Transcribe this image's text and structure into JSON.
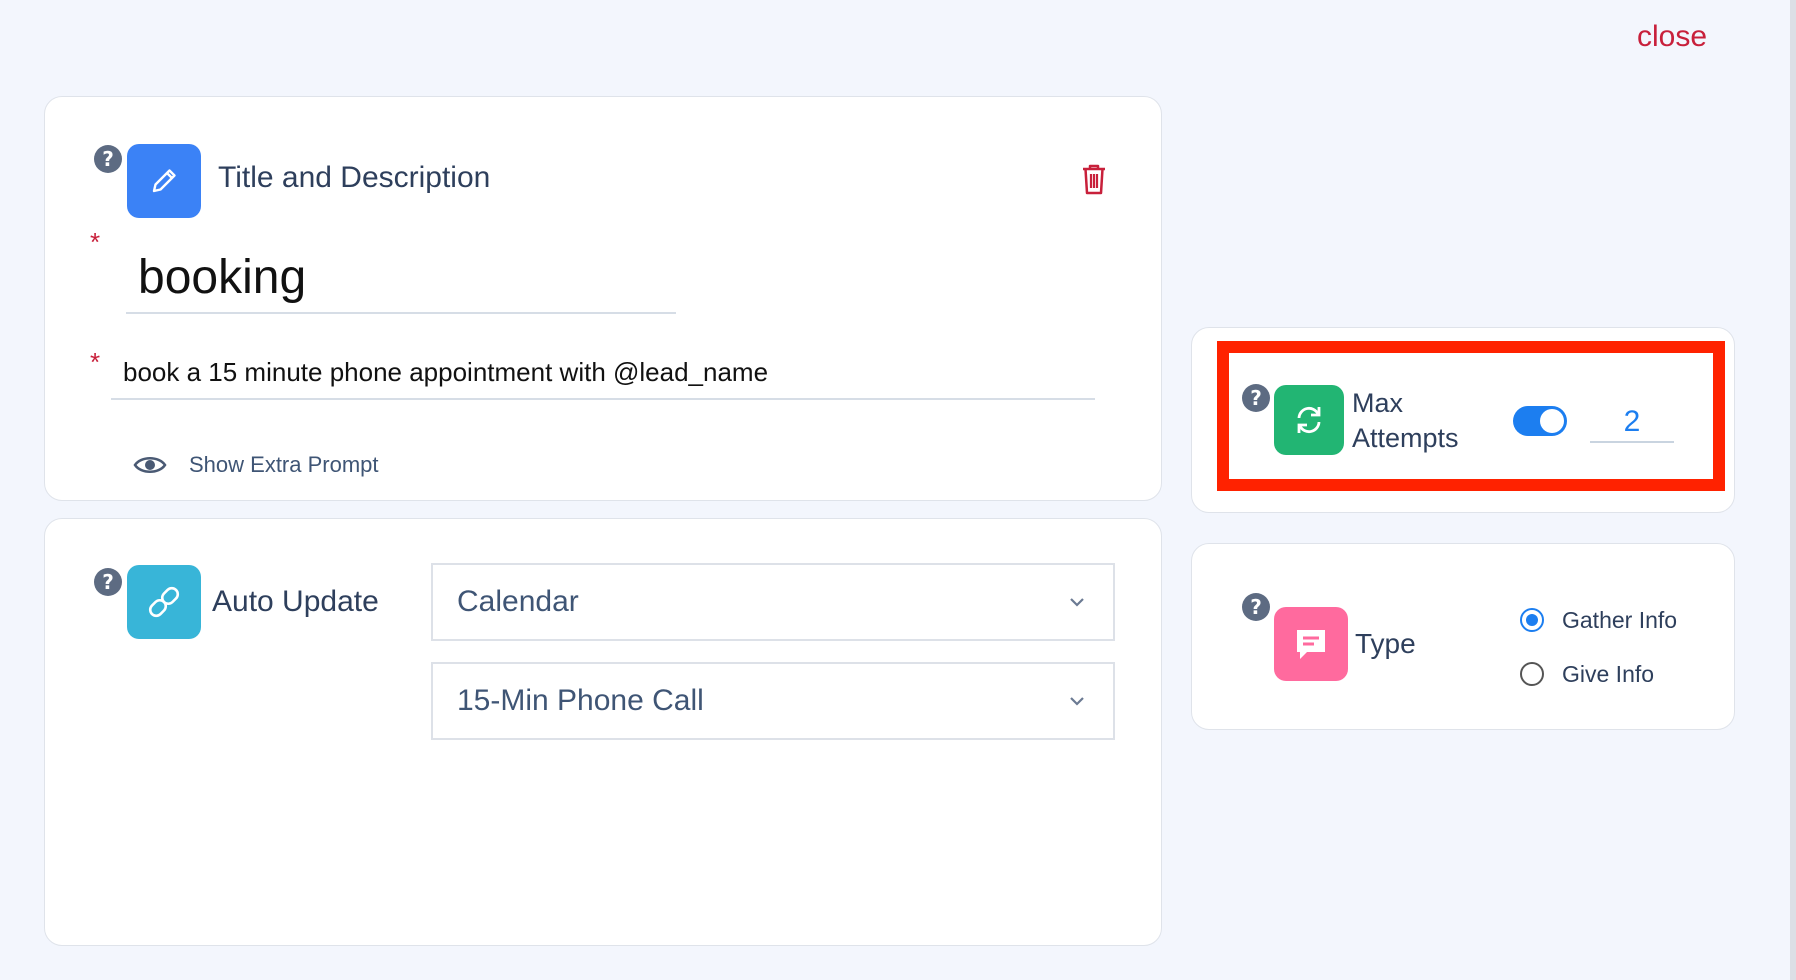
{
  "close_label": "close",
  "title_card": {
    "title": "Title and Description",
    "name_value": "booking",
    "description_value": "book a 15 minute phone appointment with @lead_name",
    "required_mark": "*",
    "help_mark": "?",
    "extra_prompt_label": "Show Extra Prompt"
  },
  "auto_update_card": {
    "title": "Auto Update",
    "help_mark": "?",
    "select_1": "Calendar",
    "select_2": "15-Min Phone Call"
  },
  "max_attempts_card": {
    "title_line1": "Max",
    "title_line2": "Attempts",
    "help_mark": "?",
    "toggle_on": true,
    "value": "2"
  },
  "type_card": {
    "title": "Type",
    "help_mark": "?",
    "options": [
      "Gather Info",
      "Give Info"
    ],
    "selected": "Gather Info"
  },
  "colors": {
    "accent_blue": "#1c7ef0",
    "danger_red": "#c8203b",
    "highlight_red": "#ff2200",
    "pencil_tile": "#3b82f6",
    "link_tile": "#38b5d8",
    "refresh_tile": "#22b573",
    "type_tile": "#ff6a9e"
  },
  "icons": [
    "question-icon",
    "pencil-icon",
    "trash-icon",
    "eye-icon",
    "link-icon",
    "refresh-icon",
    "chat-icon",
    "chevron-down-icon"
  ]
}
